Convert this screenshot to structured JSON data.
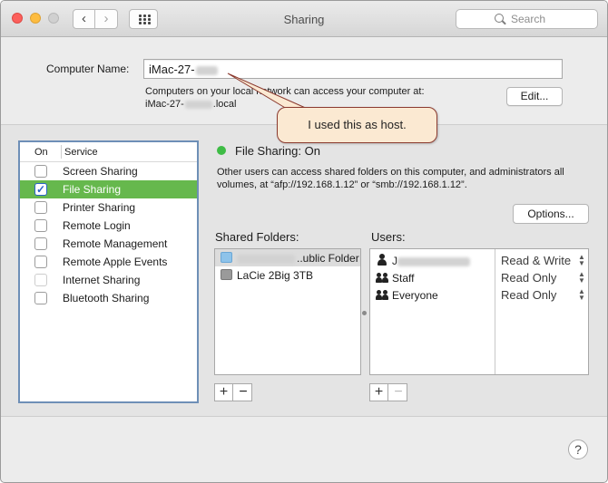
{
  "window": {
    "title": "Sharing",
    "search_placeholder": "Search",
    "nav_back": "‹",
    "nav_forward": "›"
  },
  "computer_name": {
    "label": "Computer Name:",
    "value": "iMac-27-",
    "info_line1": "Computers on your local network can access your computer at:",
    "info_line2_prefix": "iMac-27-",
    "info_line2_suffix": ".local",
    "edit_label": "Edit..."
  },
  "services": {
    "header_on": "On",
    "header_service": "Service",
    "items": [
      {
        "label": "Screen Sharing",
        "checked": false,
        "selected": false
      },
      {
        "label": "File Sharing",
        "checked": true,
        "selected": true
      },
      {
        "label": "Printer Sharing",
        "checked": false,
        "selected": false
      },
      {
        "label": "Remote Login",
        "checked": false,
        "selected": false
      },
      {
        "label": "Remote Management",
        "checked": false,
        "selected": false
      },
      {
        "label": "Remote Apple Events",
        "checked": false,
        "selected": false
      },
      {
        "label": "Internet Sharing",
        "checked": false,
        "selected": false
      },
      {
        "label": "Bluetooth Sharing",
        "checked": false,
        "selected": false
      }
    ]
  },
  "file_sharing": {
    "status": "File Sharing: On",
    "status_color": "#3ebc45",
    "description": "Other users can access shared folders on this computer, and administrators all volumes, at “afp://192.168.1.12” or “smb://192.168.1.12”.",
    "options_label": "Options...",
    "shared_folders_label": "Shared Folders:",
    "users_label": "Users:",
    "folders": [
      {
        "label": "..ublic Folder",
        "icon": "folder-icon"
      },
      {
        "label": "LaCie 2Big 3TB",
        "icon": "drive-icon"
      }
    ],
    "users": [
      {
        "label": "J",
        "icon": "user-icon",
        "permission": "Read & Write"
      },
      {
        "label": "Staff",
        "icon": "group-icon",
        "permission": "Read Only"
      },
      {
        "label": "Everyone",
        "icon": "group-icon",
        "permission": "Read Only"
      }
    ],
    "add_symbol": "+",
    "remove_symbol": "−"
  },
  "help_label": "?",
  "callout": {
    "text": "I used this as host."
  },
  "colors": {
    "selection_green": "#66b84d",
    "list_focus_border": "#6e8fb7",
    "callout_fill": "#fbe9d2",
    "callout_border": "#8b3a2f"
  }
}
